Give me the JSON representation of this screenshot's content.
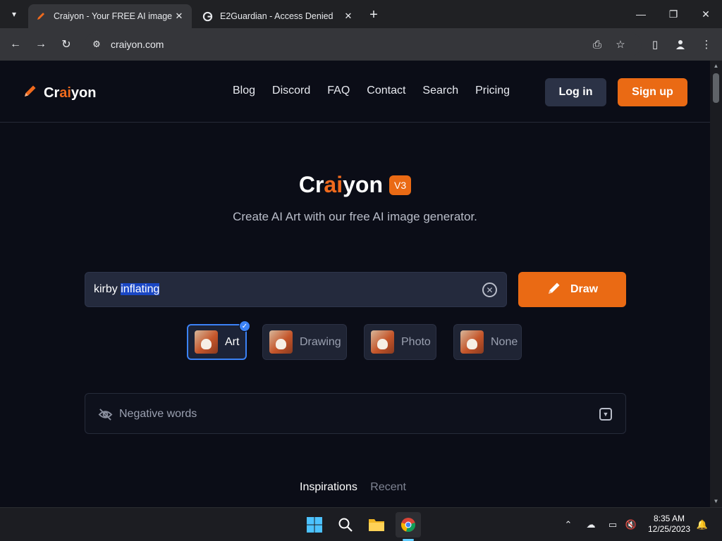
{
  "browser": {
    "tabs": [
      {
        "title": "Craiyon - Your FREE AI image g",
        "active": true,
        "favicon": "pencil-icon"
      },
      {
        "title": "E2Guardian - Access Denied",
        "active": false,
        "favicon": "google-icon"
      }
    ],
    "url": "craiyon.com"
  },
  "site": {
    "logo": {
      "part1": "Cr",
      "part2": "ai",
      "part3": "yon"
    },
    "nav": [
      "Blog",
      "Discord",
      "FAQ",
      "Contact",
      "Search",
      "Pricing"
    ],
    "login_label": "Log in",
    "signup_label": "Sign up",
    "hero": {
      "title_part1": "Cr",
      "title_part2": "ai",
      "title_part3": "yon",
      "badge": "V3",
      "subtitle": "Create AI Art with our free AI image generator."
    },
    "prompt": {
      "text_plain": "kirby ",
      "text_selected": "inflating"
    },
    "draw_label": "Draw",
    "styles": [
      {
        "label": "Art",
        "selected": true
      },
      {
        "label": "Drawing",
        "selected": false
      },
      {
        "label": "Photo",
        "selected": false
      },
      {
        "label": "None",
        "selected": false
      }
    ],
    "negative_label": "Negative words",
    "bottom_tabs": {
      "active": "Inspirations",
      "inactive": "Recent"
    }
  },
  "taskbar": {
    "time": "8:35 AM",
    "date": "12/25/2023"
  },
  "colors": {
    "accent": "#ea6a14",
    "background": "#0b0d17",
    "selection_blue": "#3b82f6"
  }
}
